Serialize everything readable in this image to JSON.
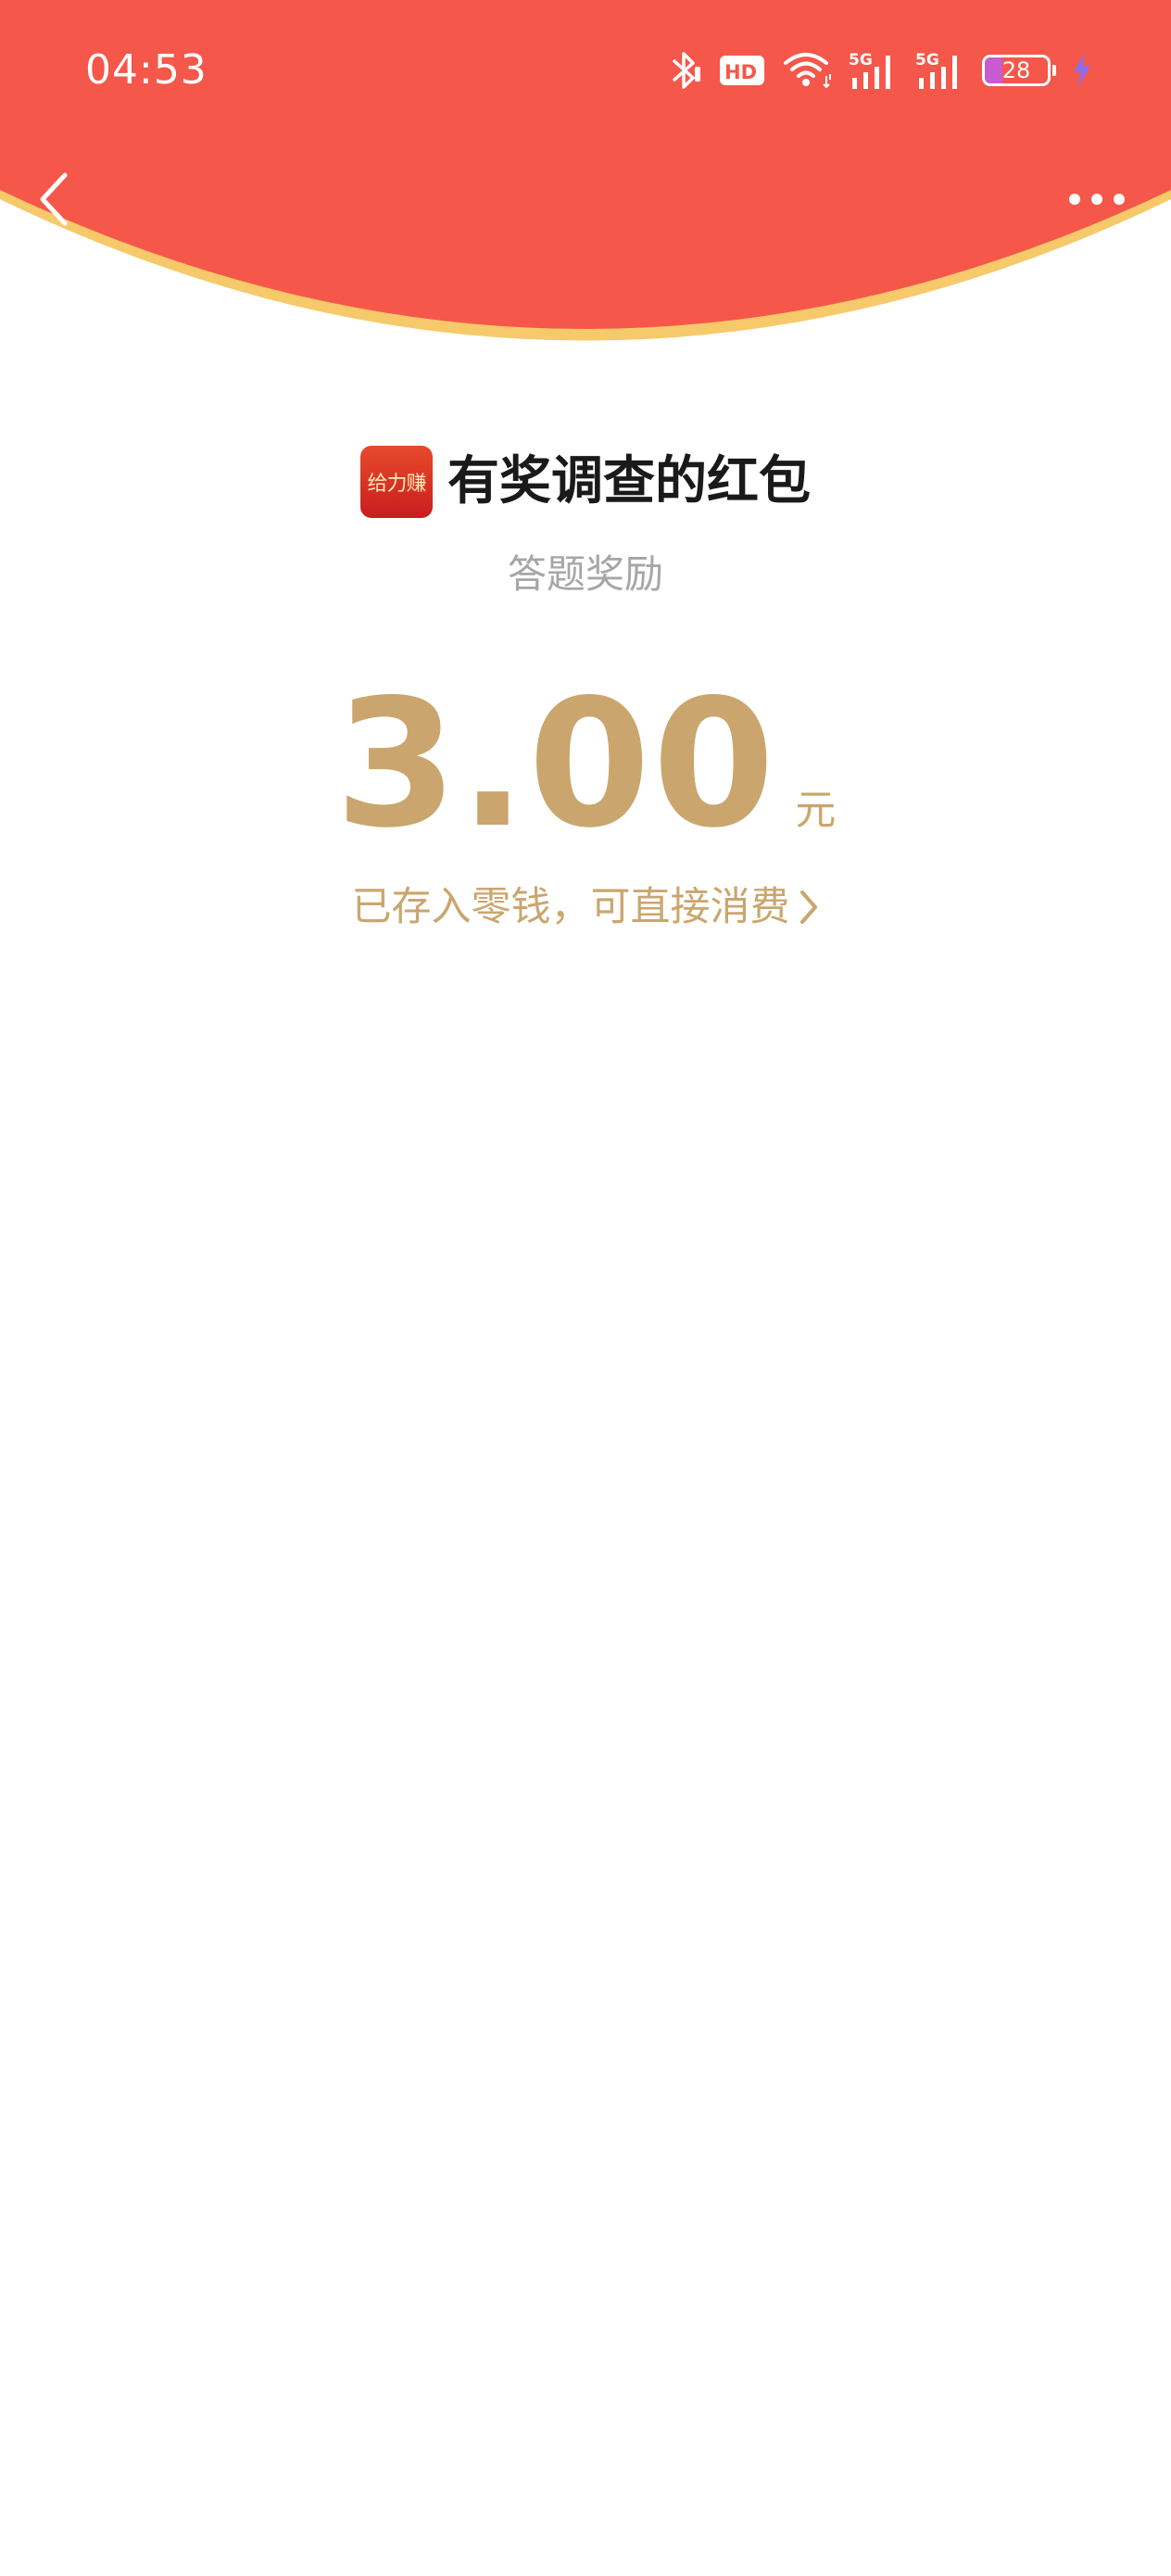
{
  "status_bar": {
    "time": "04:53",
    "battery_level": "28",
    "battery_fraction": 0.28,
    "icons": [
      "bluetooth-icon",
      "hd-voice-icon",
      "wifi-icon",
      "5g-signal-icon",
      "5g-signal-icon",
      "battery-icon",
      "charging-icon"
    ],
    "hd_label": "HD",
    "network_label": "5G"
  },
  "header": {
    "background_color": "#f5574a",
    "edge_color": "#f6c96a",
    "back_icon": "chevron-left-icon",
    "more_icon": "more-horizontal-icon"
  },
  "red_packet": {
    "app_logo_text": "给力赚",
    "title": "有奖调查的红包",
    "subtitle": "答题奖励",
    "amount": "3.00",
    "unit": "元",
    "wallet_link_text": "已存入零钱，可直接消费",
    "accent_color": "#caa66e"
  }
}
